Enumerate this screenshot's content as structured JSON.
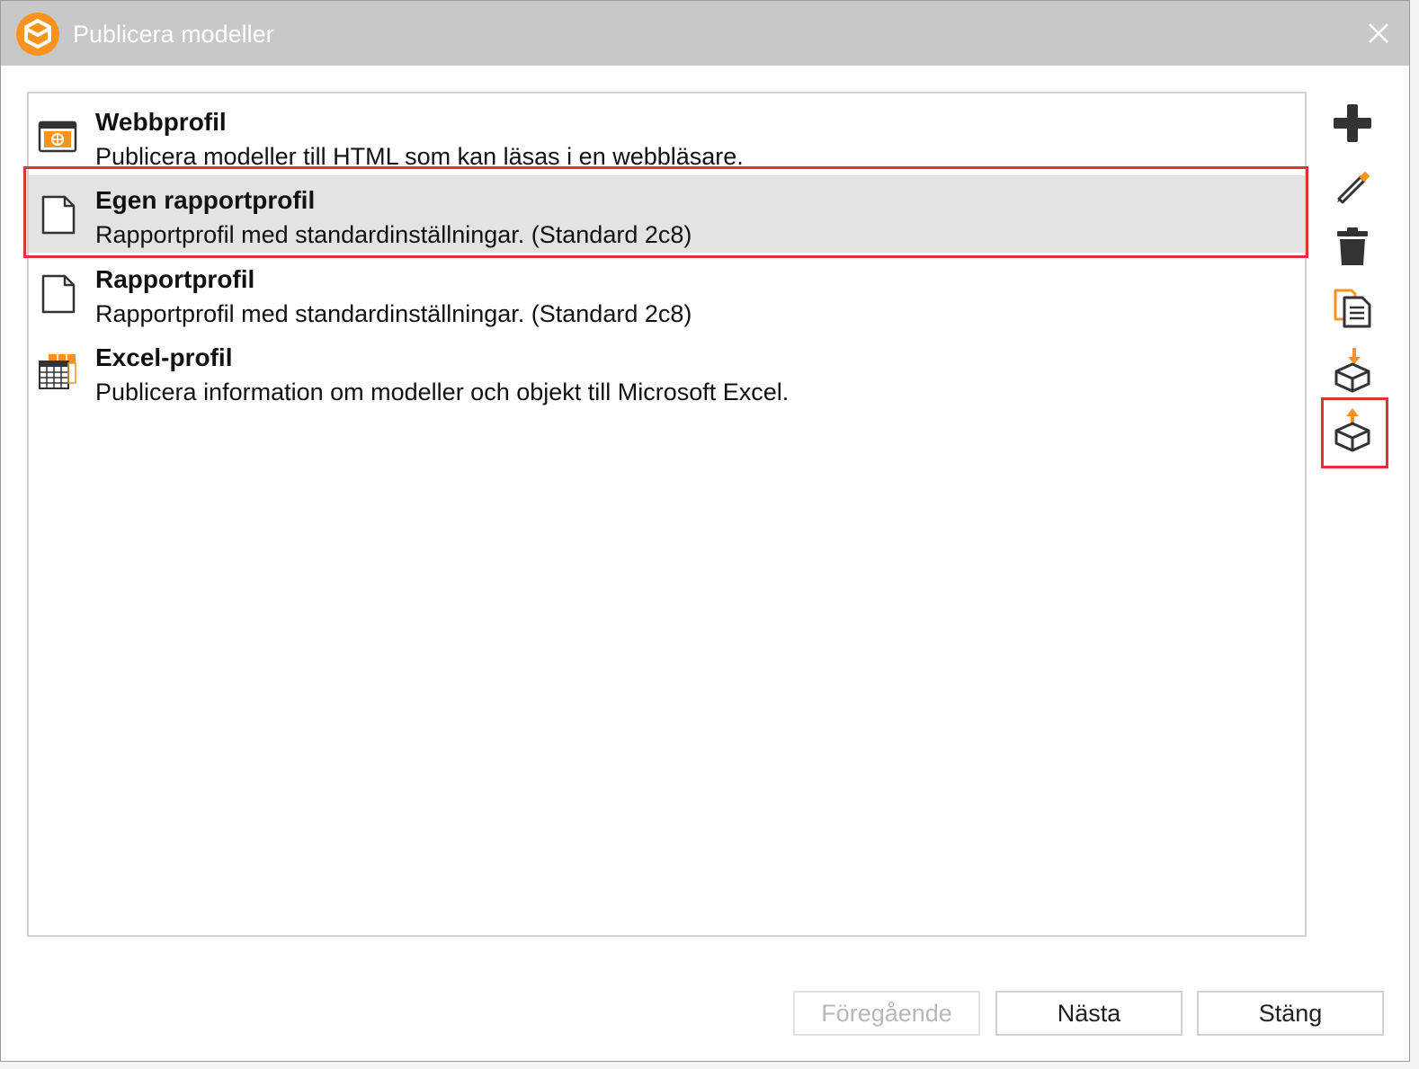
{
  "window": {
    "title": "Publicera modeller"
  },
  "colors": {
    "accent": "#f7931e",
    "titlebar": "#c8c8c8",
    "highlight": "#e0313d",
    "selected_row": "#e3e3e3"
  },
  "profiles": [
    {
      "title": "Webbprofil",
      "description": "Publicera modeller till HTML som kan läsas i en webbläsare.",
      "icon": "web-browser-icon"
    },
    {
      "title": "Egen rapportprofil",
      "description": "Rapportprofil med standardinställningar. (Standard 2c8)",
      "icon": "document-icon",
      "selected": true
    },
    {
      "title": "Rapportprofil",
      "description": "Rapportprofil med standardinställningar. (Standard 2c8)",
      "icon": "document-icon"
    },
    {
      "title": "Excel-profil",
      "description": "Publicera information om modeller och objekt till Microsoft Excel.",
      "icon": "spreadsheet-icon"
    }
  ],
  "toolbar": [
    {
      "name": "add-profile-button",
      "icon": "plus-icon"
    },
    {
      "name": "edit-profile-button",
      "icon": "pencil-icon"
    },
    {
      "name": "delete-profile-button",
      "icon": "trash-icon"
    },
    {
      "name": "copy-profile-button",
      "icon": "copy-document-icon"
    },
    {
      "name": "import-profile-button",
      "icon": "box-import-icon"
    },
    {
      "name": "export-profile-button",
      "icon": "box-export-icon"
    }
  ],
  "buttons": {
    "previous": "Föregående",
    "next": "Nästa",
    "close": "Stäng"
  }
}
